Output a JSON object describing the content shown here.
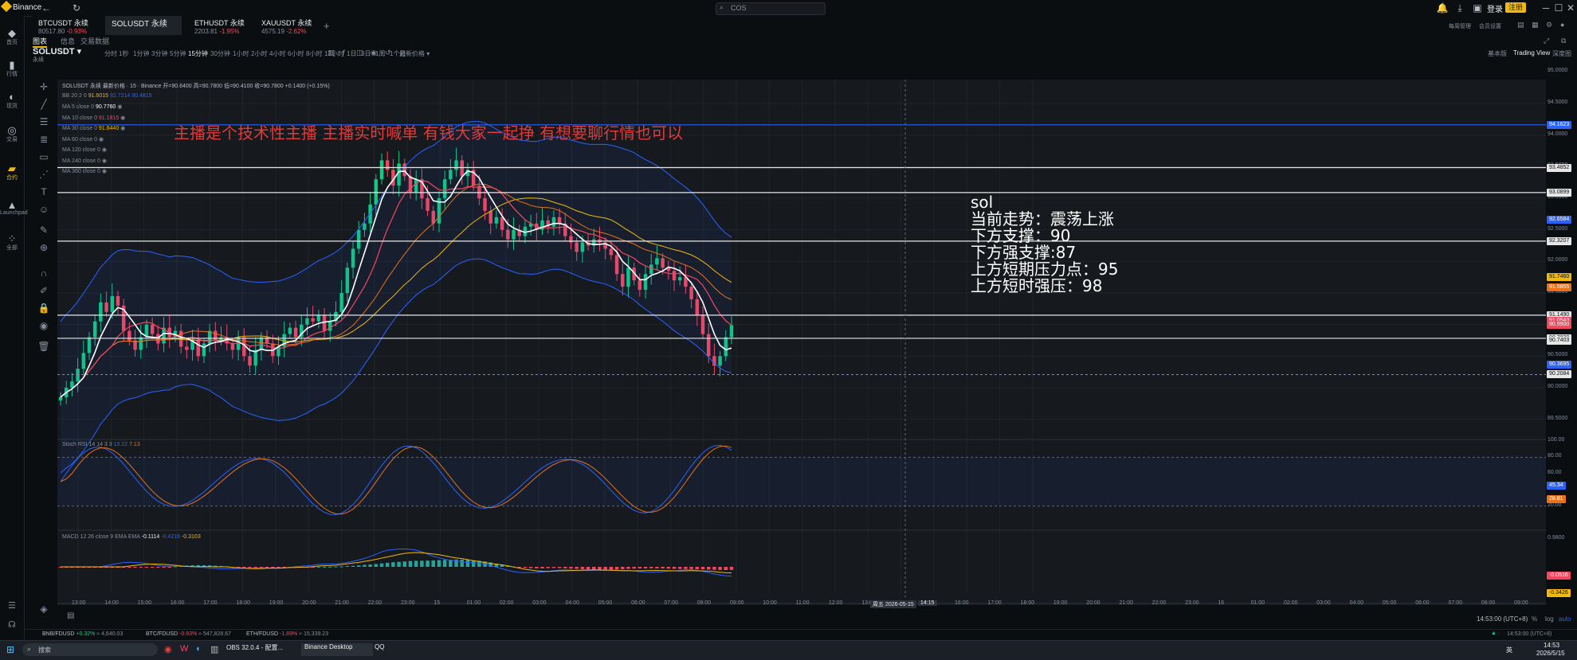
{
  "window": {
    "app_title": "Binance",
    "search_placeholder": "COS",
    "login": "登录",
    "register": "注册",
    "right_tools": [
      "每周管理",
      "会员设置"
    ]
  },
  "tabs": [
    {
      "name": "BTCUSDT 永续",
      "price": "80517.80",
      "change": "-0.93%",
      "dir": "neg",
      "active": false
    },
    {
      "name": "SOLUSDT 永续",
      "price": "",
      "change": "",
      "dir": "neg",
      "active": true
    },
    {
      "name": "ETHUSDT 永续",
      "price": "2203.81",
      "change": "-1.95%",
      "dir": "neg",
      "active": false
    },
    {
      "name": "XAUUSDT 永续",
      "price": "4575.19",
      "change": "-2.62%",
      "dir": "neg",
      "active": false
    }
  ],
  "leftnav": [
    {
      "label": "首页",
      "icon": "home-icon"
    },
    {
      "label": "行情",
      "icon": "chart-icon"
    },
    {
      "label": "现货",
      "icon": "spot-icon"
    },
    {
      "label": "交易",
      "icon": "trade-icon"
    },
    {
      "label": "合约",
      "icon": "futures-icon",
      "active": true
    },
    {
      "label": "Launchpad",
      "icon": "launchpad-icon"
    },
    {
      "label": "全部",
      "icon": "grid-icon"
    }
  ],
  "subtabs": [
    "图表",
    "信息",
    "交易数据"
  ],
  "symbol": {
    "name": "SOLUSDT",
    "sub": "永续"
  },
  "timeframes": [
    "分时",
    "1秒",
    "1分钟",
    "3分钟",
    "5分钟",
    "15分钟",
    "30分钟",
    "1小时",
    "2小时",
    "4小时",
    "6小时",
    "8小时",
    "12小时",
    "1日",
    "3日",
    "1周",
    "1个月"
  ],
  "active_timeframe": "15分钟",
  "indicator_dropdown": "最新价格",
  "view_types": [
    "基本版",
    "Trading View",
    "深度图"
  ],
  "active_view": "Trading View",
  "legends": {
    "main": "SOLUSDT 永续 最新价格 · 15 · Binance  开=90.6400 高=90.7800 低=90.4100 收=90.7800 +0.1400 (+0.15%)",
    "bb_label": "BB 20 2 0",
    "bb_vals": [
      "91.6015",
      "92.7214",
      "90.4815"
    ],
    "ma": [
      {
        "label": "MA 5 close 0",
        "value": "90.7760",
        "color": "#ffffff"
      },
      {
        "label": "MA 10 close 0",
        "value": "91.1815",
        "color": "#f6465d"
      },
      {
        "label": "MA 30 close 0",
        "value": "91.8440",
        "color": "#f0b90b"
      },
      {
        "label": "MA 60 close 0",
        "value": "",
        "color": "#848e9c"
      },
      {
        "label": "MA 120 close 0",
        "value": "",
        "color": "#848e9c"
      },
      {
        "label": "MA 240 close 0",
        "value": "",
        "color": "#848e9c"
      },
      {
        "label": "MA 360 close 0",
        "value": "",
        "color": "#848e9c"
      }
    ],
    "stoch": {
      "label": "Stoch RSI 14 14 3 3",
      "k": "15.22",
      "d": "7.13"
    },
    "macd": {
      "label": "MACD 12 26 close 9 EMA EMA",
      "v1": "-0.1114",
      "v2": "-0.4216",
      "v3": "-0.3103"
    }
  },
  "banner": "主播是个技术性主播 主播实时喊单 有钱大家一起挣 有想要聊行情也可以",
  "analysis": {
    "title": "sol",
    "lines": [
      "当前走势：震荡上涨",
      "下方支撑：90",
      "下方强支撑:87",
      "上方短期压力点：95",
      "上方短时强压：98"
    ]
  },
  "price_axis": {
    "ticks": [
      "95.0000",
      "94.5000",
      "94.0000",
      "93.5000",
      "93.0000",
      "92.5000",
      "92.0000",
      "91.5000",
      "91.0000",
      "90.5000",
      "90.0000",
      "89.5000"
    ],
    "tags": [
      {
        "text": "94.1623",
        "color": "#2962ff",
        "price": 94.1623
      },
      {
        "text": "93.4852",
        "color": "#e6e6e6",
        "price": 93.4852
      },
      {
        "text": "93.0899",
        "color": "#e6e6e6",
        "price": 93.0899
      },
      {
        "text": "92.6584",
        "color": "#2962ff",
        "price": 92.6584
      },
      {
        "text": "92.3207",
        "color": "#e6e6e6",
        "price": 92.3207
      },
      {
        "text": "91.7460",
        "color": "#f0b90b",
        "price": 91.746
      },
      {
        "text": "91.5855",
        "color": "#e8711a",
        "price": 91.5855
      },
      {
        "text": "91.1490",
        "color": "#e6e6e6",
        "price": 91.149
      },
      {
        "text": "91.0543",
        "color": "#f6465d",
        "price": 91.0543
      },
      {
        "text": "90.9900",
        "color": "#f6465d",
        "price": 90.99
      },
      {
        "text": "90.7820",
        "color": "#e6e6e6",
        "price": 90.782
      },
      {
        "text": "90.7403",
        "color": "#e6e6e6",
        "price": 90.7403
      },
      {
        "text": "90.3695",
        "color": "#2962ff",
        "price": 90.3695
      },
      {
        "text": "90.2084",
        "color": "#e6e6e6",
        "price": 90.2084
      }
    ],
    "stoch_ticks": [
      "100.00",
      "80.00",
      "60.00",
      "40.00",
      "20.00"
    ],
    "stoch_tags": [
      {
        "text": "45.34",
        "color": "#2962ff"
      },
      {
        "text": "28.81",
        "color": "#e8711a"
      }
    ],
    "macd_ticks": [
      "0.9800"
    ],
    "macd_tags": [
      {
        "text": "-0.0516",
        "color": "#f6465d"
      },
      {
        "text": "-0.3426",
        "color": "#f0b90b"
      }
    ]
  },
  "time_axis": [
    "13:00",
    "14:00",
    "15:00",
    "16:00",
    "17:00",
    "18:00",
    "19:00",
    "20:00",
    "21:00",
    "22:00",
    "23:00",
    "15",
    "01:00",
    "02:00",
    "03:00",
    "04:00",
    "05:00",
    "06:00",
    "07:00",
    "08:00",
    "09:00",
    "10:00",
    "11:00",
    "12:00",
    "13:00",
    "周五 2026-05-15",
    "14:15",
    "16:00",
    "17:00",
    "18:00",
    "19:00",
    "20:00",
    "21:00",
    "22:00",
    "23:00",
    "16",
    "01:00",
    "02:00",
    "03:00",
    "04:00",
    "05:00",
    "06:00",
    "07:00",
    "08:00",
    "09:00"
  ],
  "status": {
    "clock": "14:53:00 (UTC+8)",
    "pct": "%",
    "log": "log",
    "auto": "auto"
  },
  "ticker": [
    {
      "sym": "BNB/FDUSD",
      "chg": "+0.32%",
      "dir": "pos",
      "price": "≈ 4,640.03"
    },
    {
      "sym": "BTC/FDUSD",
      "chg": "-0.93%",
      "dir": "neg",
      "price": "≈ 547,828.67"
    },
    {
      "sym": "ETH/FDUSD",
      "chg": "-1.89%",
      "dir": "neg",
      "price": "≈ 15,339.23"
    }
  ],
  "taskbar": {
    "search": "搜索",
    "apps": [
      "OBS 32.0.4 - 配置...",
      "Binance Desktop",
      "QQ"
    ],
    "time": "14:53",
    "date": "2026/5/15",
    "lang": "英"
  }
}
